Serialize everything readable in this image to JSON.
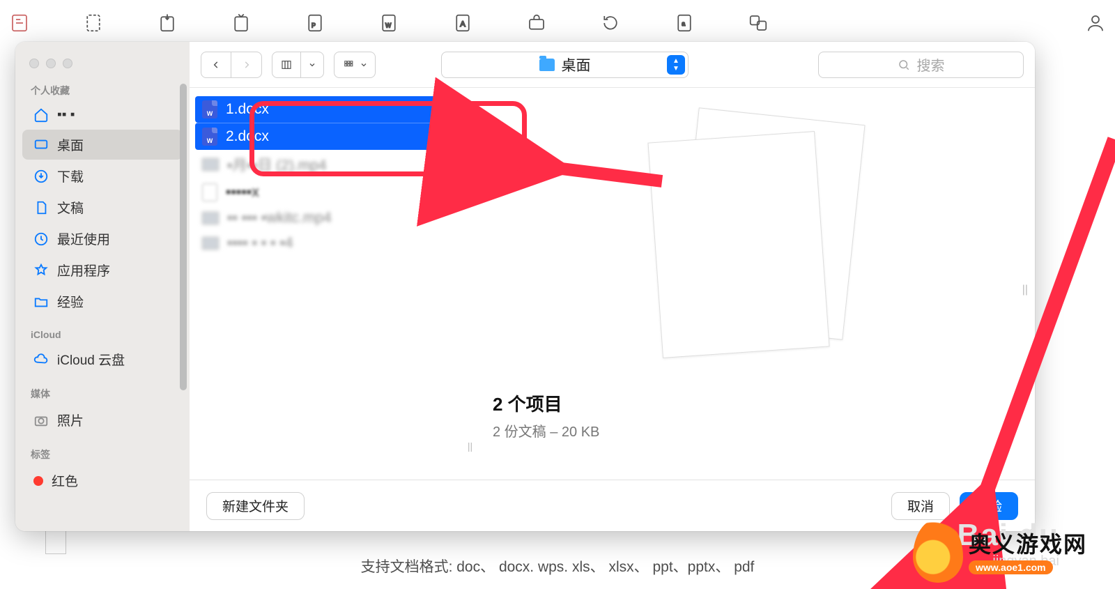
{
  "toolbar_icons": [
    "pdf-icon",
    "page-icon",
    "convert-icon",
    "import-icon",
    "pdf-page-icon",
    "word-icon",
    "text-icon",
    "toolbox-icon",
    "rotate-icon",
    "doc-a-icon",
    "translate-icon",
    "user-icon"
  ],
  "sidebar": {
    "favorites_label": "个人收藏",
    "icloud_label": "iCloud",
    "media_label": "媒体",
    "tags_label": "标签",
    "items": [
      {
        "icon": "home",
        "label": "▪▪ ▪"
      },
      {
        "icon": "desktop",
        "label": "桌面",
        "active": true
      },
      {
        "icon": "download",
        "label": "下载"
      },
      {
        "icon": "doc",
        "label": "文稿"
      },
      {
        "icon": "clock",
        "label": "最近使用"
      },
      {
        "icon": "app",
        "label": "应用程序"
      },
      {
        "icon": "folder",
        "label": "经验"
      }
    ],
    "icloud_item": "iCloud 云盘",
    "photos": "照片",
    "red_tag": "红色"
  },
  "finder": {
    "location": "桌面",
    "search_placeholder": "搜索"
  },
  "files": [
    {
      "name": "1.docx",
      "type": "docx",
      "selected": true
    },
    {
      "name": "2.docx",
      "type": "docx",
      "selected": true
    },
    {
      "name": "▪月▪▪日 (2).mp4",
      "type": "dim",
      "selected": false
    },
    {
      "name": "▪▪▪▪▪x",
      "type": "generic",
      "selected": false
    },
    {
      "name": "▪▪ ▪▪▪   ▪wkitc.mp4",
      "type": "thumb",
      "selected": false
    },
    {
      "name": "▪▪▪▪ ▪ ▪ ▪ ▪4",
      "type": "thumb",
      "selected": false
    }
  ],
  "preview": {
    "title": "2 个项目",
    "subtitle": "2 份文稿 – 20 KB"
  },
  "footer": {
    "new_folder": "新建文件夹",
    "cancel": "取消",
    "open": "经验"
  },
  "formats_line": "支持文档格式: doc、 docx. wps. xls、 xlsx、 ppt、pptx、 pdf",
  "watermark": {
    "brand": "Bai du",
    "sub": "jingyan.bai"
  },
  "logo": {
    "cn": "奥义游戏网",
    "url": "www.aoe1.com"
  }
}
